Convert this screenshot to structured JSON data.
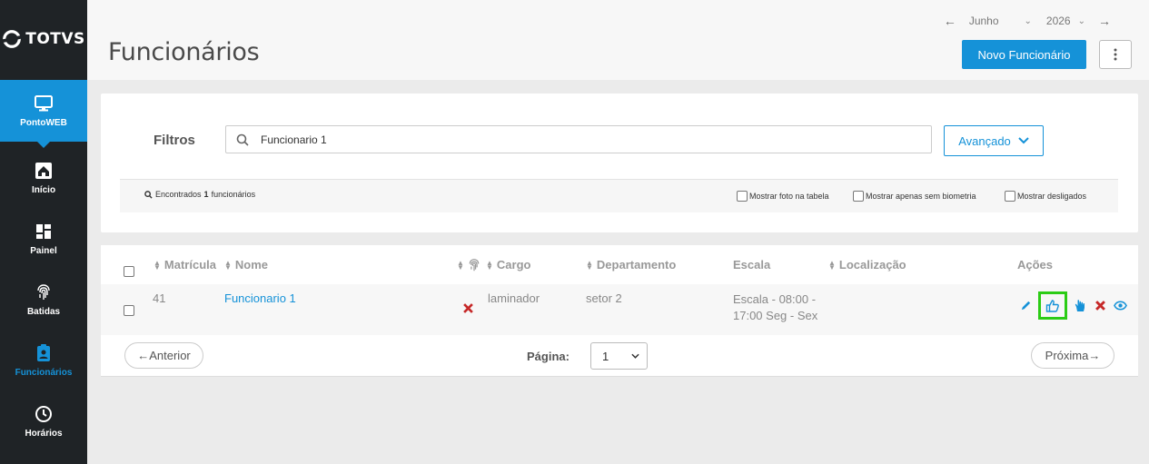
{
  "sidebar": {
    "logo_text": "TOTVS",
    "items": [
      {
        "label": "PontoWEB",
        "icon": "monitor-icon"
      },
      {
        "label": "Início",
        "icon": "home-icon"
      },
      {
        "label": "Painel",
        "icon": "dashboard-icon"
      },
      {
        "label": "Batidas",
        "icon": "fingerprint-icon"
      },
      {
        "label": "Funcionários",
        "icon": "id-badge-icon"
      },
      {
        "label": "Horários",
        "icon": "clock-icon"
      }
    ],
    "active_color": "#1592d8"
  },
  "header": {
    "title": "Funcionários",
    "month": "Junho",
    "year": "2026",
    "new_button": "Novo Funcionário"
  },
  "filters": {
    "label": "Filtros",
    "search_value": "Funcionario 1",
    "advanced_button": "Avançado",
    "found_prefix": "Encontrados",
    "found_count": "1",
    "found_suffix": "funcionários",
    "options": [
      "Mostrar foto na tabela",
      "Mostrar apenas sem biometria",
      "Mostrar desligados"
    ]
  },
  "table": {
    "headers": {
      "matricula": "Matrícula",
      "nome": "Nome",
      "cargo": "Cargo",
      "departamento": "Departamento",
      "escala": "Escala",
      "localizacao": "Localização",
      "acoes": "Ações"
    },
    "rows": [
      {
        "matricula": "41",
        "nome": "Funcionario 1",
        "cargo": "laminador",
        "departamento": "setor 2",
        "escala_line1": "Escala - 08:00 -",
        "escala_line2": "17:00 Seg - Sex"
      }
    ]
  },
  "pagination": {
    "prev": "←Anterior",
    "page_label": "Página:",
    "page_value": "1",
    "next": "Próxima→"
  },
  "colors": {
    "primary": "#1592d8",
    "highlight": "#2bcc15",
    "danger": "#c62828",
    "sidebar_bg": "#1f2326"
  }
}
